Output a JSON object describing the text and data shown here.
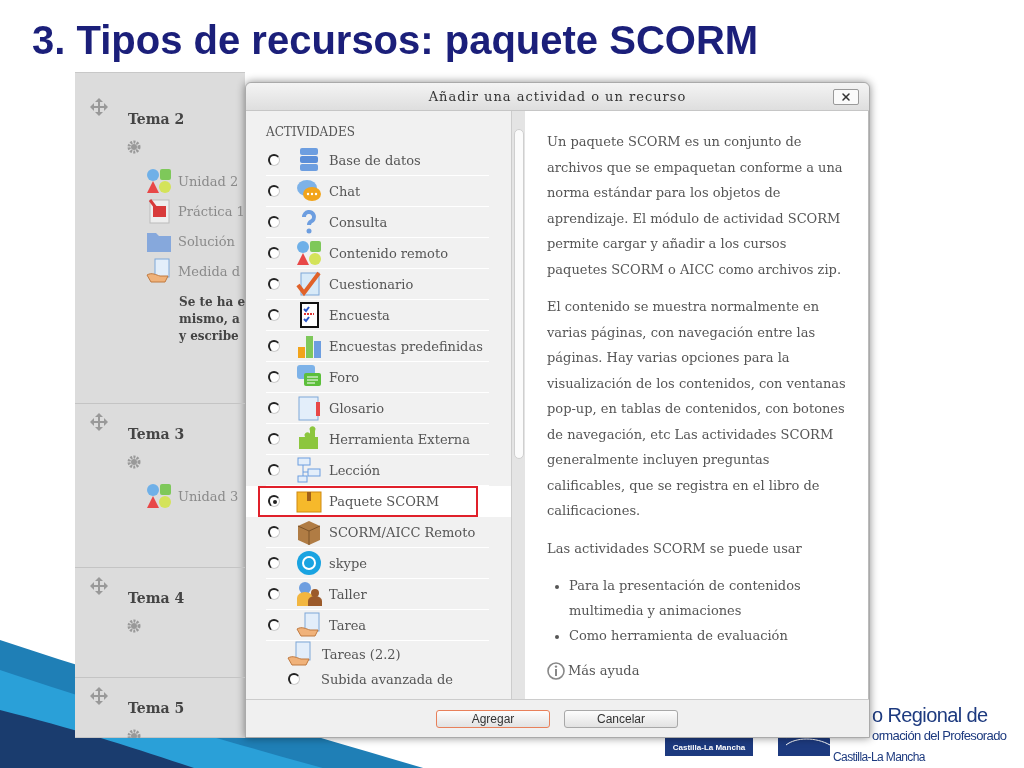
{
  "title": "3. Tipos de recursos: paquete SCORM",
  "course": {
    "sections": [
      {
        "title": "Tema 2",
        "items": [
          "Unidad 2",
          "Práctica 1",
          "Solución",
          "Medida d"
        ],
        "note": [
          "Se te ha e",
          "mismo, a",
          "y escribe"
        ]
      },
      {
        "title": "Tema 3",
        "items": [
          "Unidad 3"
        ]
      },
      {
        "title": "Tema 4"
      },
      {
        "title": "Tema 5"
      }
    ]
  },
  "dialog": {
    "title": "Añadir una actividad o un recurso",
    "section": "ACTIVIDADES",
    "options": [
      {
        "label": "Base de datos",
        "selected": false
      },
      {
        "label": "Chat",
        "selected": false
      },
      {
        "label": "Consulta",
        "selected": false
      },
      {
        "label": "Contenido remoto",
        "selected": false
      },
      {
        "label": "Cuestionario",
        "selected": false
      },
      {
        "label": "Encuesta",
        "selected": false
      },
      {
        "label": "Encuestas predefinidas",
        "selected": false
      },
      {
        "label": "Foro",
        "selected": false
      },
      {
        "label": "Glosario",
        "selected": false
      },
      {
        "label": "Herramienta Externa",
        "selected": false
      },
      {
        "label": "Lección",
        "selected": false
      },
      {
        "label": "Paquete SCORM",
        "selected": true
      },
      {
        "label": "SCORM/AICC Remoto",
        "selected": false
      },
      {
        "label": "skype",
        "selected": false
      },
      {
        "label": "Taller",
        "selected": false
      },
      {
        "label": "Tarea",
        "selected": false
      }
    ],
    "subgroup": {
      "label": "Tareas (2.2)",
      "options": [
        {
          "label": "Subida avanzada de",
          "selected": false
        }
      ]
    },
    "description": {
      "paragraphs": [
        "Un paquete SCORM es un conjunto de archivos que se empaquetan conforme a una norma estándar para los objetos de aprendizaje. El módulo de actividad SCORM permite cargar y añadir a los cursos paquetes SCORM o AICC como archivos zip.",
        "El contenido se muestra normalmente en varias páginas, con navegación entre las páginas. Hay varias opciones para la visualización de los contenidos, con ventanas pop-up, en tablas de contenidos, con botones de navegación, etc Las actividades SCORM generalmente incluyen preguntas calificables, que se registra en el libro de calificaciones.",
        "Las actividades SCORM se puede usar"
      ],
      "bullets": [
        "Para la presentación de contenidos multimedia y animaciones",
        "Como herramienta de evaluación"
      ],
      "help": "Más ayuda"
    },
    "buttons": [
      {
        "label": "Agregar",
        "primary": true
      },
      {
        "label": "Cancelar",
        "primary": false
      }
    ]
  },
  "footer": {
    "left_logo": "Castilla-La Mancha",
    "right_logo": [
      "o Regional de",
      "ormación del Profesorado",
      "Castilla-La Mancha"
    ]
  }
}
